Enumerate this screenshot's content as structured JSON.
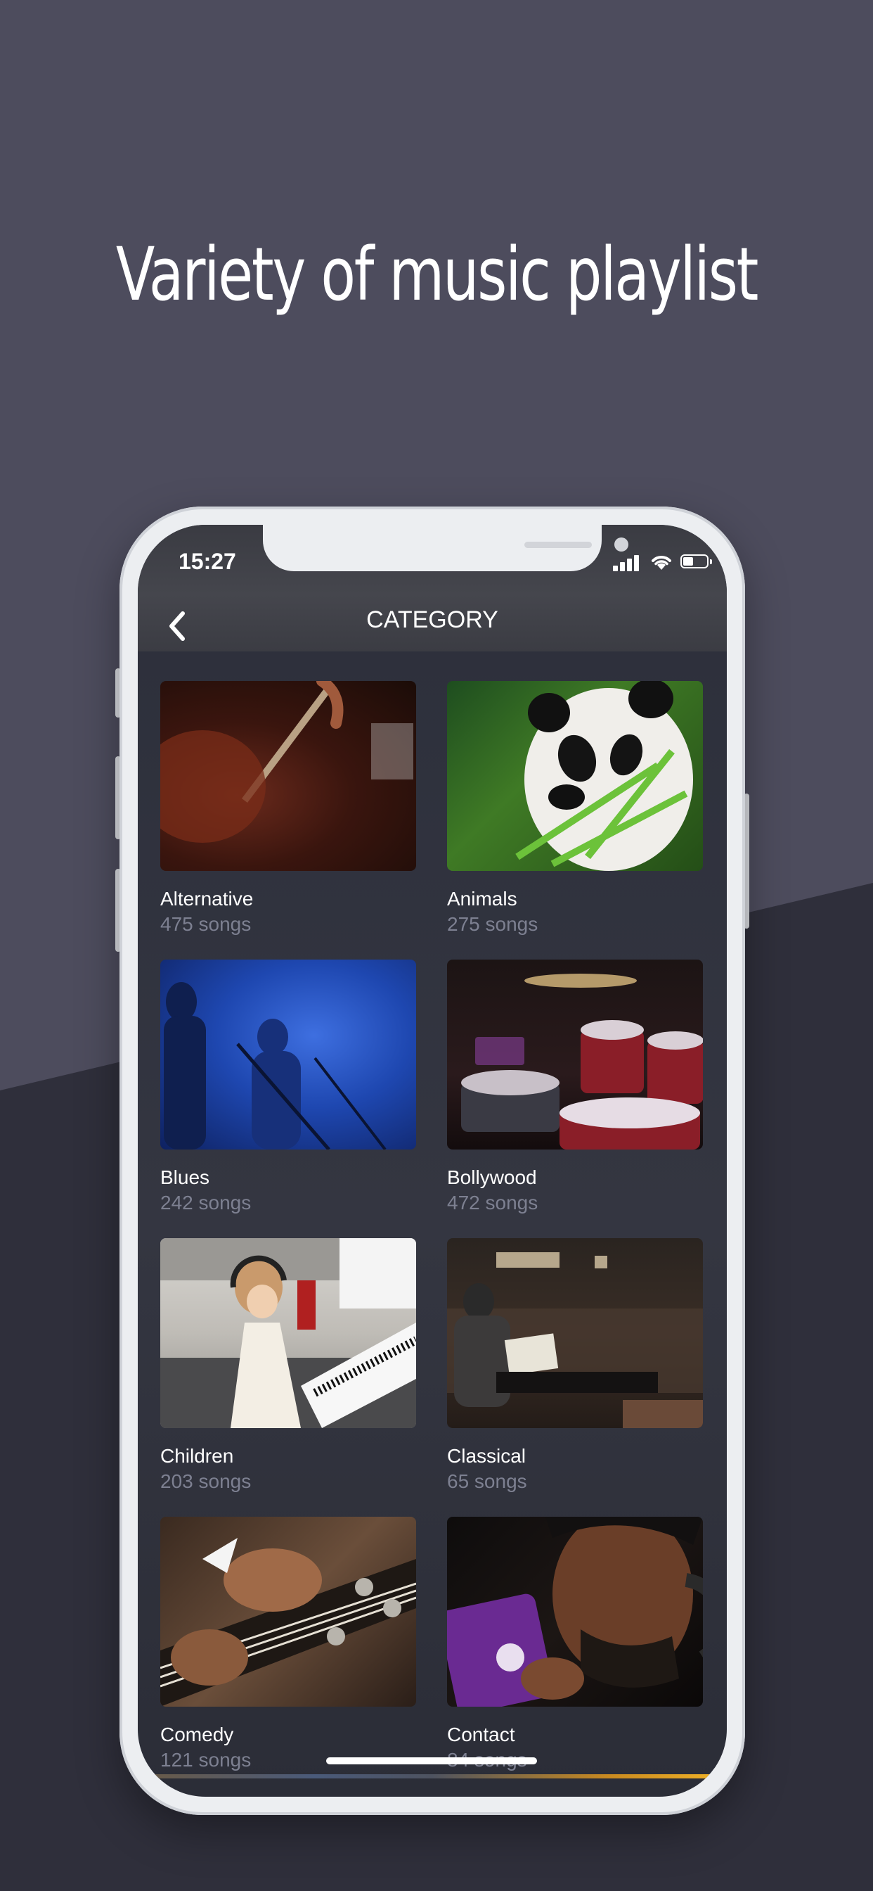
{
  "headline": "Variety of music playlist",
  "status_bar": {
    "time": "15:27"
  },
  "nav": {
    "title": "CATEGORY",
    "back_icon": "chevron-left-icon"
  },
  "categories": [
    {
      "name": "Alternative",
      "count": "475 songs",
      "image": "bass-guitar-player-photo"
    },
    {
      "name": "Animals",
      "count": "275 songs",
      "image": "panda-eating-bamboo-photo"
    },
    {
      "name": "Blues",
      "count": "242 songs",
      "image": "singer-on-blue-stage-photo"
    },
    {
      "name": "Bollywood",
      "count": "472 songs",
      "image": "drum-kit-photo"
    },
    {
      "name": "Children",
      "count": "203 songs",
      "image": "girl-playing-piano-photo"
    },
    {
      "name": "Classical",
      "count": "65 songs",
      "image": "pianist-concert-hall-photo"
    },
    {
      "name": "Comedy",
      "count": "121 songs",
      "image": "guitar-headstock-photo"
    },
    {
      "name": "Contact",
      "count": "84 songs",
      "image": "man-with-headphones-phone-photo"
    }
  ],
  "colors": {
    "background_upper": "#4d4c5d",
    "background_lower": "#2f2f3b",
    "secondary_text": "#7d8091"
  }
}
